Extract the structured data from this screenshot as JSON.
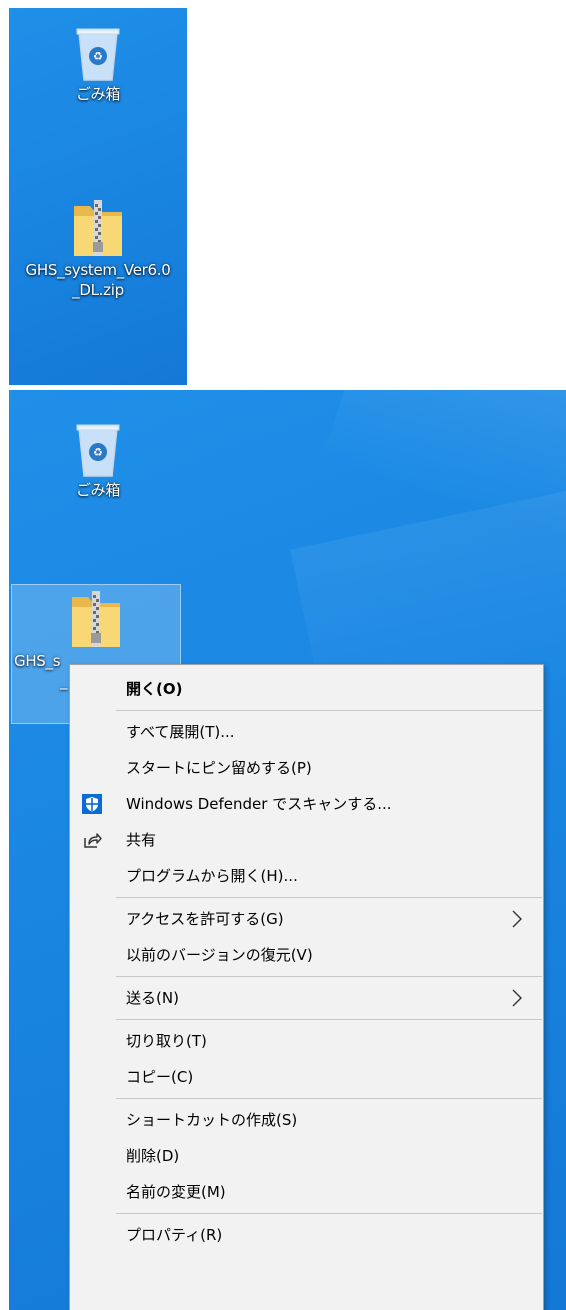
{
  "desktop_top": {
    "recycle_bin_label": "ごみ箱",
    "zip_file_label": "GHS_system_Ver6.0\n_DL.zip"
  },
  "desktop_bottom": {
    "recycle_bin_label": "ごみ箱",
    "zip_file_label_visible": "GHS_s",
    "zip_file_label_line2": "_"
  },
  "context_menu": {
    "open": "開く(O)",
    "extract_all": "すべて展開(T)...",
    "pin_to_start": "スタートにピン留めする(P)",
    "defender_scan": "Windows Defender でスキャンする...",
    "share": "共有",
    "open_with": "プログラムから開く(H)...",
    "give_access": "アクセスを許可する(G)",
    "restore_versions": "以前のバージョンの復元(V)",
    "send_to": "送る(N)",
    "cut": "切り取り(T)",
    "copy": "コピー(C)",
    "create_shortcut": "ショートカットの作成(S)",
    "delete": "削除(D)",
    "rename": "名前の変更(M)",
    "properties": "プロパティ(R)"
  },
  "icons": {
    "recycle_bin": "recycle-bin-icon",
    "zip_folder": "zip-folder-icon",
    "defender": "shield-icon",
    "share": "share-icon",
    "submenu": "chevron-right-icon"
  },
  "colors": {
    "desktop_blue": "#1a86e2",
    "menu_bg": "#f2f2f2",
    "defender_blue": "#0a6cd4"
  }
}
